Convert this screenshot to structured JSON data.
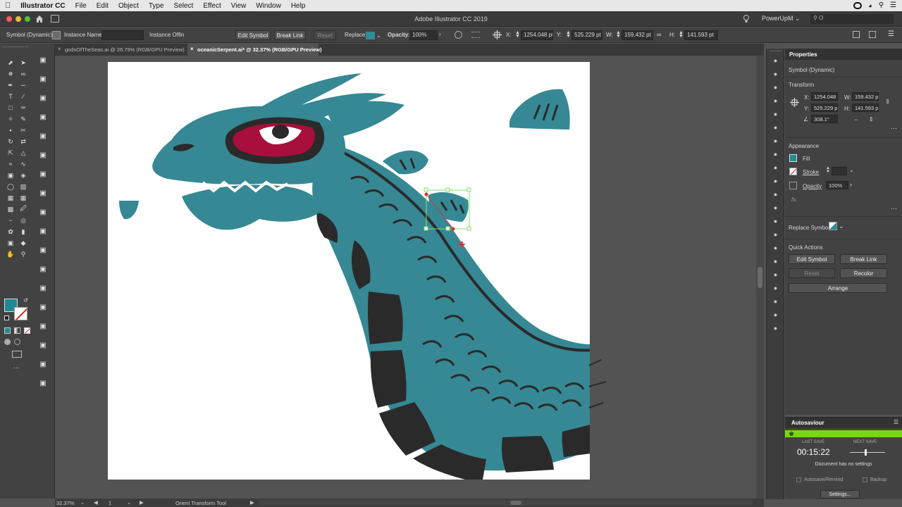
{
  "menubar": {
    "app_name": "Illustrator CC",
    "items": [
      "File",
      "Edit",
      "Object",
      "Type",
      "Select",
      "Effect",
      "View",
      "Window",
      "Help"
    ]
  },
  "titlebar": {
    "title": "Adobe Illustrator CC 2019",
    "workspace": "PowerUpM",
    "search_placeholder": "O"
  },
  "control_bar": {
    "selection_type": "Symbol (Dynamic)",
    "instance_name_label": "Instance Name:",
    "instance_name_value": "",
    "instance_of_label": "Instance Of:",
    "instance_of_value": "fin",
    "edit_symbol": "Edit Symbol",
    "break_link": "Break Link",
    "reset": "Reset",
    "replace_label": "Replace:",
    "opacity_label": "Opacity:",
    "opacity_value": "100%",
    "x_label": "X:",
    "x_value": "1254.048 pt",
    "y_label": "Y:",
    "y_value": "525.229 pt",
    "w_label": "W:",
    "w_value": "159.432 pt",
    "h_label": "H:",
    "h_value": "141.593 pt"
  },
  "tabs": [
    {
      "label": "godsOfTheSeas.ai @ 26.79% (RGB/GPU Preview)",
      "active": false
    },
    {
      "label": "oceanicSerpent.ai* @ 32.37% (RGB/GPU Preview)",
      "active": true
    }
  ],
  "properties": {
    "panel_title": "Properties",
    "selection_type": "Symbol (Dynamic)",
    "transform_title": "Transform",
    "x_label": "X:",
    "x_value": "1254.048 p",
    "y_label": "Y:",
    "y_value": "525.229 p",
    "w_label": "W:",
    "w_value": "159.432 p",
    "h_label": "H:",
    "h_value": "141.593 p",
    "rotate_value": "308.1°",
    "appearance_title": "Appearance",
    "fill_label": "Fill",
    "stroke_label": "Stroke",
    "opacity_label": "Opacity",
    "opacity_value": "100%",
    "fx_label": "fx.",
    "replace_symbol_label": "Replace Symbol:",
    "quick_actions_title": "Quick Actions",
    "edit_symbol": "Edit Symbol",
    "break_link": "Break Link",
    "reset": "Reset",
    "recolor": "Recolor",
    "arrange": "Arrange"
  },
  "autosave": {
    "title": "Autosaviour",
    "last_save_label": "LAST SAVE",
    "last_save_value": "00:15:22",
    "next_save_label": "NEXT SAVE",
    "message": "Document has no settings",
    "save_remind_label": "Autosave/Remind",
    "backup_label": "Backup",
    "settings_button": "Settings..."
  },
  "statusbar": {
    "zoom": "32.37%",
    "artboard": "1",
    "current_tool": "Orient Transform Tool"
  },
  "colors": {
    "fill_swatch": "#1f8a94",
    "serpent_body": "#368894",
    "serpent_dark": "#2a2a2a",
    "eye_red": "#a80f3c",
    "selection_green": "#7ee36a",
    "autosave_green": "#7ad41e"
  }
}
